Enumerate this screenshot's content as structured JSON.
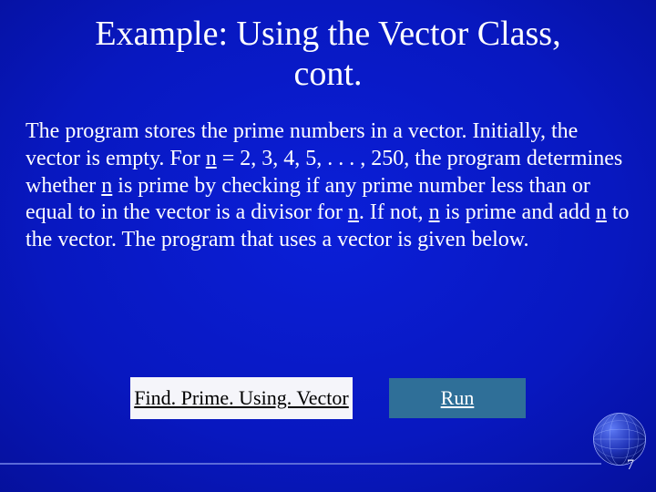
{
  "title_line1": "Example: Using the Vector Class,",
  "title_line2": "cont.",
  "body": {
    "t1": "The program stores the prime numbers in a vector. Initially, the vector is empty. For ",
    "n1": "n",
    "t2": " = 2, 3, 4, 5, . . . , 250, the program determines whether ",
    "n2": "n",
    "t3": " is prime by checking if any prime number less than or equal to in the vector is a divisor for ",
    "n3": "n",
    "t4": ". If not, ",
    "n4": "n",
    "t5": " is prime and add ",
    "n5": "n",
    "t6": " to the vector. The program that uses a vector is given below."
  },
  "buttons": {
    "find_label": "Find. Prime. Using. Vector",
    "run_label": "Run"
  },
  "page_number": "7"
}
